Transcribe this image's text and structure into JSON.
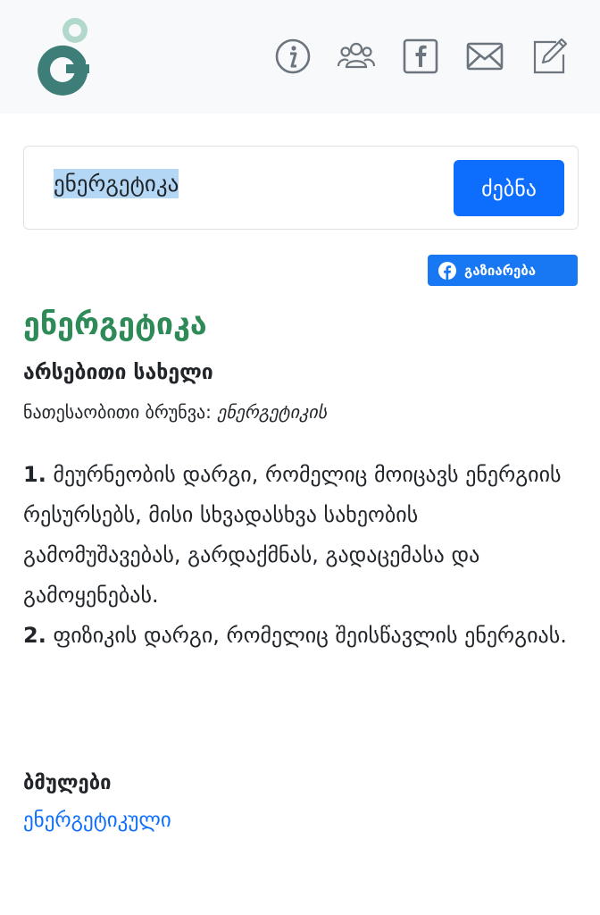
{
  "colors": {
    "accent": "#0d6efd",
    "title": "#2e8b57",
    "facebook": "#1877f2",
    "header_bg": "#f8f9fa"
  },
  "header": {
    "icons": [
      "info-icon",
      "users-icon",
      "facebook-icon",
      "mail-icon",
      "edit-icon"
    ]
  },
  "search": {
    "value": "ენერგეტიკა",
    "button_label": "ძებნა"
  },
  "share": {
    "label": "გაზიარება"
  },
  "entry": {
    "word": "ენერგეტიკა",
    "part_of_speech": "არსებითი სახელი",
    "genitive_label": "ნათესაობითი ბრუნვა:",
    "genitive_value": "ენერგეტიკის",
    "definitions": [
      {
        "num": "1.",
        "text": "მეურნეობის დარგი, რომელიც მოიცავს ენერგიის რესურსებს, მისი სხვადასხვა სახეობის გამომუშავებას, გარდაქმნას, გადაცემასა და გამოყენებას."
      },
      {
        "num": "2.",
        "text": "ფიზიკის დარგი, რომელიც შეისწავლის ენერგიას."
      }
    ]
  },
  "related": {
    "title": "ბმულები",
    "links": [
      "ენერგეტიკული"
    ]
  }
}
